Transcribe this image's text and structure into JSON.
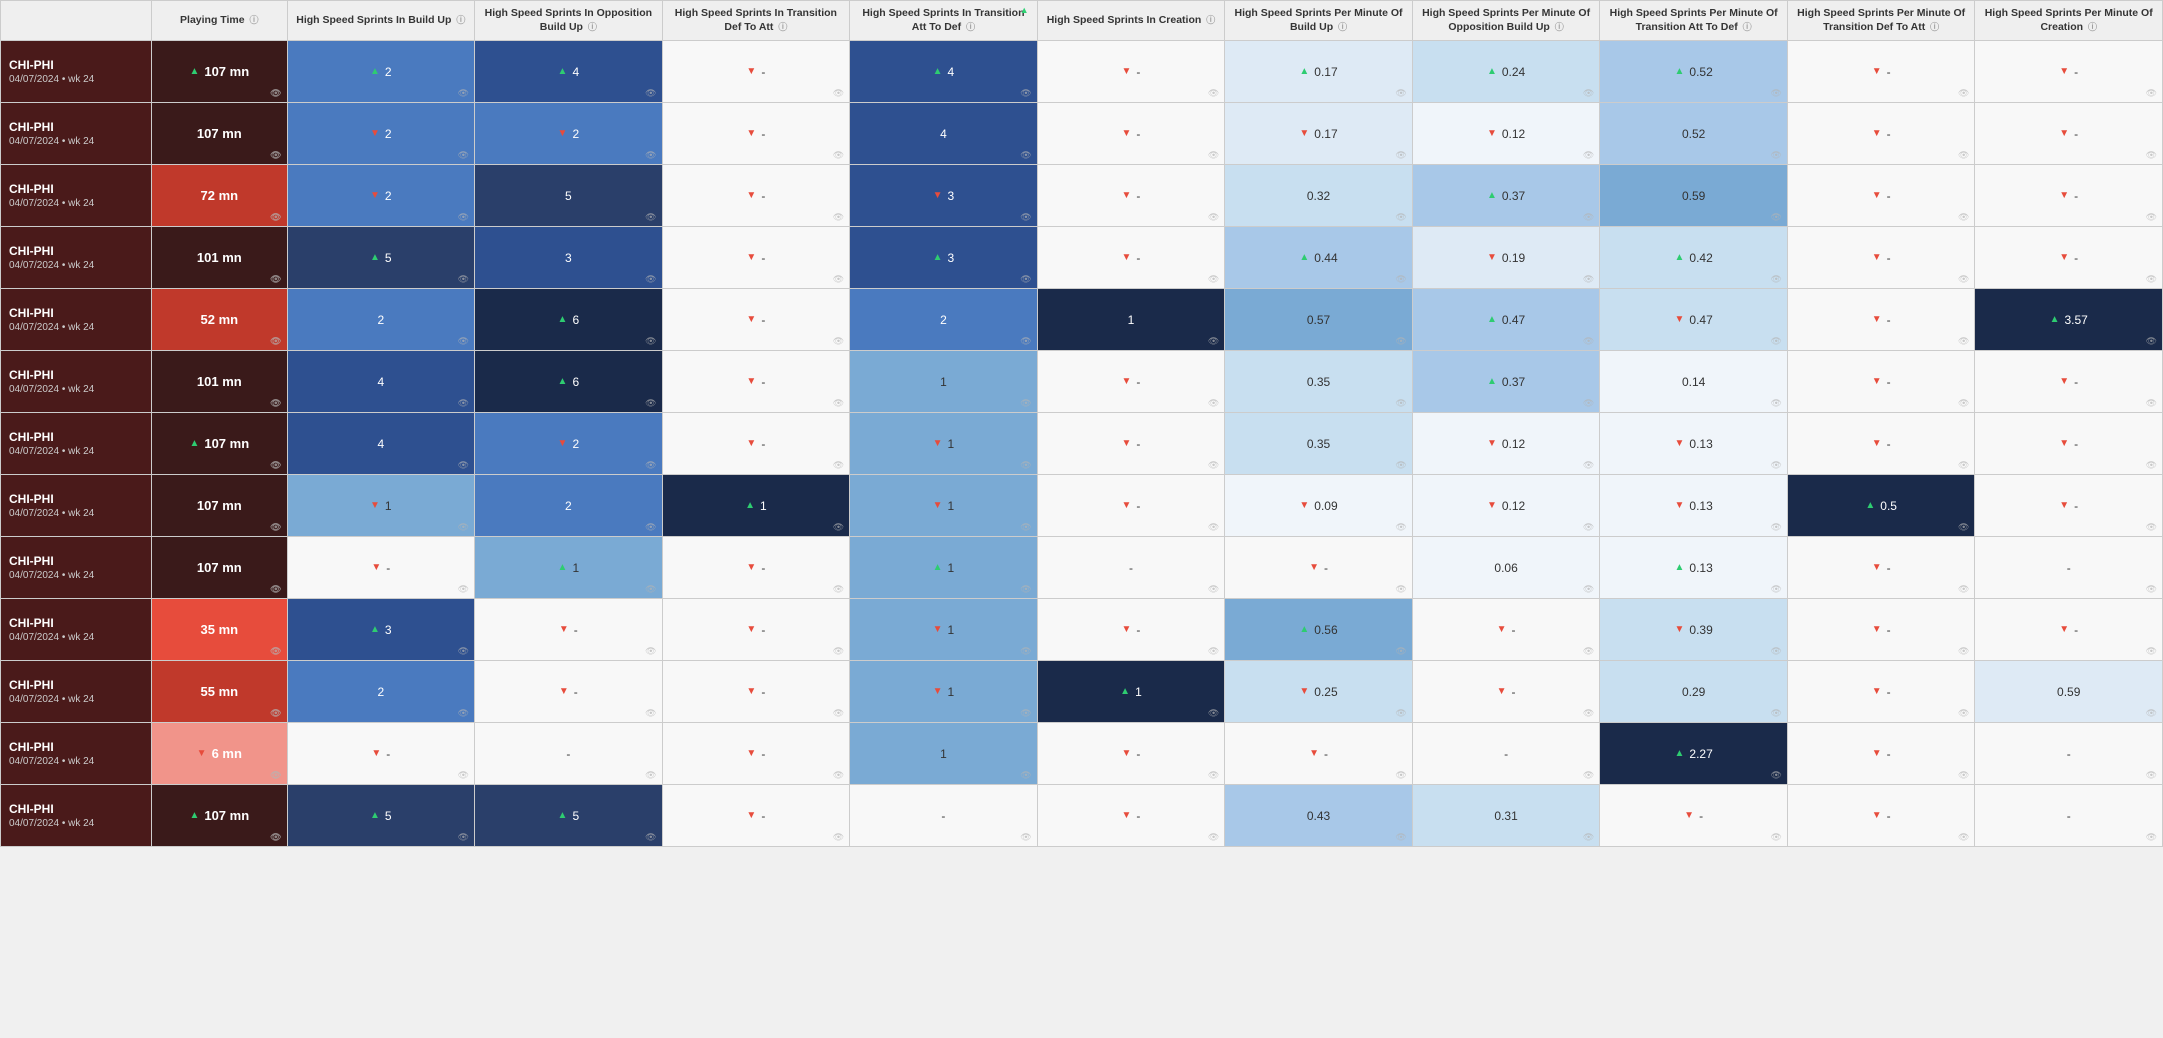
{
  "columns": [
    {
      "id": "player",
      "label": ""
    },
    {
      "id": "playing_time",
      "label": "Playing Time"
    },
    {
      "id": "hs_buildup",
      "label": "High Speed Sprints In Build Up"
    },
    {
      "id": "hs_opp_buildup",
      "label": "High Speed Sprints In Opposition Build Up"
    },
    {
      "id": "hs_trans_def_att",
      "label": "High Speed Sprints In Transition Def To Att"
    },
    {
      "id": "hs_trans_att_def",
      "label": "High Speed Sprints In Transition Att To Def"
    },
    {
      "id": "hs_creation",
      "label": "High Speed Sprints In Creation"
    },
    {
      "id": "hs_pm_buildup",
      "label": "High Speed Sprints Per Minute Of Build Up"
    },
    {
      "id": "hs_pm_opp_buildup",
      "label": "High Speed Sprints Per Minute Of Opposition Build Up"
    },
    {
      "id": "hs_pm_trans_att_def",
      "label": "High Speed Sprints Per Minute Of Transition Att To Def"
    },
    {
      "id": "hs_pm_trans_def_att",
      "label": "High Speed Sprints Per Minute Of Transition Def To Att"
    },
    {
      "id": "hs_pm_creation",
      "label": "High Speed Sprints Per Minute Of Creation"
    }
  ],
  "rows": [
    {
      "player": "CHI-PHI",
      "date": "04/07/2024 • wk 24",
      "pt_value": "107 mn",
      "pt_class": "pt-dark",
      "pt_arrow": "up",
      "hs_buildup": {
        "val": "2",
        "arrow": "up",
        "bg": "bg-medblue"
      },
      "hs_opp_buildup": {
        "val": "4",
        "arrow": "up",
        "bg": "bg-darkblue"
      },
      "hs_trans_def_att": {
        "val": "-",
        "arrow": "down",
        "bg": "bg-plain"
      },
      "hs_trans_att_def": {
        "val": "4",
        "arrow": "up",
        "bg": "bg-darkblue"
      },
      "hs_creation": {
        "val": "-",
        "arrow": "down",
        "bg": "bg-plain"
      },
      "hs_pm_buildup": {
        "val": "0.17",
        "arrow": "up",
        "bg": "bg-verylight"
      },
      "hs_pm_opp_buildup": {
        "val": "0.24",
        "arrow": "up",
        "bg": "bg-paleblue"
      },
      "hs_pm_trans_att_def": {
        "val": "0.52",
        "arrow": "up",
        "bg": "bg-lighterblue"
      },
      "hs_pm_trans_def_att": {
        "val": "-",
        "arrow": "down",
        "bg": "bg-plain"
      },
      "hs_pm_creation": {
        "val": "-",
        "arrow": "down",
        "bg": "bg-plain"
      }
    },
    {
      "player": "CHI-PHI",
      "date": "04/07/2024 • wk 24",
      "pt_value": "107 mn",
      "pt_class": "pt-dark",
      "pt_arrow": "none",
      "hs_buildup": {
        "val": "2",
        "arrow": "down",
        "bg": "bg-medblue"
      },
      "hs_opp_buildup": {
        "val": "2",
        "arrow": "down",
        "bg": "bg-medblue"
      },
      "hs_trans_def_att": {
        "val": "-",
        "arrow": "down",
        "bg": "bg-plain"
      },
      "hs_trans_att_def": {
        "val": "4",
        "arrow": "none",
        "bg": "bg-darkblue"
      },
      "hs_creation": {
        "val": "-",
        "arrow": "down",
        "bg": "bg-plain"
      },
      "hs_pm_buildup": {
        "val": "0.17",
        "arrow": "down",
        "bg": "bg-verylight"
      },
      "hs_pm_opp_buildup": {
        "val": "0.12",
        "arrow": "down",
        "bg": "bg-white"
      },
      "hs_pm_trans_att_def": {
        "val": "0.52",
        "arrow": "none",
        "bg": "bg-lighterblue"
      },
      "hs_pm_trans_def_att": {
        "val": "-",
        "arrow": "down",
        "bg": "bg-plain"
      },
      "hs_pm_creation": {
        "val": "-",
        "arrow": "down",
        "bg": "bg-plain"
      }
    },
    {
      "player": "CHI-PHI",
      "date": "04/07/2024 • wk 24",
      "pt_value": "72 mn",
      "pt_class": "pt-red-dark",
      "pt_arrow": "none",
      "hs_buildup": {
        "val": "2",
        "arrow": "down",
        "bg": "bg-medblue"
      },
      "hs_opp_buildup": {
        "val": "5",
        "arrow": "none",
        "bg": "bg-navy"
      },
      "hs_trans_def_att": {
        "val": "-",
        "arrow": "down",
        "bg": "bg-plain"
      },
      "hs_trans_att_def": {
        "val": "3",
        "arrow": "down",
        "bg": "bg-darkblue"
      },
      "hs_creation": {
        "val": "-",
        "arrow": "down",
        "bg": "bg-plain"
      },
      "hs_pm_buildup": {
        "val": "0.32",
        "arrow": "none",
        "bg": "bg-paleblue"
      },
      "hs_pm_opp_buildup": {
        "val": "0.37",
        "arrow": "up",
        "bg": "bg-lighterblue"
      },
      "hs_pm_trans_att_def": {
        "val": "0.59",
        "arrow": "none",
        "bg": "bg-lightblue"
      },
      "hs_pm_trans_def_att": {
        "val": "-",
        "arrow": "down",
        "bg": "bg-plain"
      },
      "hs_pm_creation": {
        "val": "-",
        "arrow": "down",
        "bg": "bg-plain"
      }
    },
    {
      "player": "CHI-PHI",
      "date": "04/07/2024 • wk 24",
      "pt_value": "101 mn",
      "pt_class": "pt-dark",
      "pt_arrow": "none",
      "hs_buildup": {
        "val": "5",
        "arrow": "up",
        "bg": "bg-navy"
      },
      "hs_opp_buildup": {
        "val": "3",
        "arrow": "none",
        "bg": "bg-darkblue"
      },
      "hs_trans_def_att": {
        "val": "-",
        "arrow": "down",
        "bg": "bg-plain"
      },
      "hs_trans_att_def": {
        "val": "3",
        "arrow": "up",
        "bg": "bg-darkblue"
      },
      "hs_creation": {
        "val": "-",
        "arrow": "down",
        "bg": "bg-plain"
      },
      "hs_pm_buildup": {
        "val": "0.44",
        "arrow": "up",
        "bg": "bg-lighterblue"
      },
      "hs_pm_opp_buildup": {
        "val": "0.19",
        "arrow": "down",
        "bg": "bg-verylight"
      },
      "hs_pm_trans_att_def": {
        "val": "0.42",
        "arrow": "up",
        "bg": "bg-paleblue"
      },
      "hs_pm_trans_def_att": {
        "val": "-",
        "arrow": "down",
        "bg": "bg-plain"
      },
      "hs_pm_creation": {
        "val": "-",
        "arrow": "down",
        "bg": "bg-plain"
      }
    },
    {
      "player": "CHI-PHI",
      "date": "04/07/2024 • wk 24",
      "pt_value": "52 mn",
      "pt_class": "pt-red-dark",
      "pt_arrow": "none",
      "hs_buildup": {
        "val": "2",
        "arrow": "none",
        "bg": "bg-medblue"
      },
      "hs_opp_buildup": {
        "val": "6",
        "arrow": "up",
        "bg": "bg-darknavy"
      },
      "hs_trans_def_att": {
        "val": "-",
        "arrow": "down",
        "bg": "bg-plain"
      },
      "hs_trans_att_def": {
        "val": "2",
        "arrow": "none",
        "bg": "bg-medblue"
      },
      "hs_creation": {
        "val": "1",
        "arrow": "none",
        "bg": "bg-darknavy"
      },
      "hs_pm_buildup": {
        "val": "0.57",
        "arrow": "none",
        "bg": "bg-lightblue"
      },
      "hs_pm_opp_buildup": {
        "val": "0.47",
        "arrow": "up",
        "bg": "bg-lighterblue"
      },
      "hs_pm_trans_att_def": {
        "val": "0.47",
        "arrow": "down",
        "bg": "bg-paleblue"
      },
      "hs_pm_trans_def_att": {
        "val": "-",
        "arrow": "down",
        "bg": "bg-plain"
      },
      "hs_pm_creation": {
        "val": "3.57",
        "arrow": "up",
        "bg": "bg-darknavy"
      }
    },
    {
      "player": "CHI-PHI",
      "date": "04/07/2024 • wk 24",
      "pt_value": "101 mn",
      "pt_class": "pt-dark",
      "pt_arrow": "none",
      "hs_buildup": {
        "val": "4",
        "arrow": "none",
        "bg": "bg-darkblue"
      },
      "hs_opp_buildup": {
        "val": "6",
        "arrow": "up",
        "bg": "bg-darknavy"
      },
      "hs_trans_def_att": {
        "val": "-",
        "arrow": "down",
        "bg": "bg-plain"
      },
      "hs_trans_att_def": {
        "val": "1",
        "arrow": "none",
        "bg": "bg-lightblue"
      },
      "hs_creation": {
        "val": "-",
        "arrow": "down",
        "bg": "bg-plain"
      },
      "hs_pm_buildup": {
        "val": "0.35",
        "arrow": "none",
        "bg": "bg-paleblue"
      },
      "hs_pm_opp_buildup": {
        "val": "0.37",
        "arrow": "up",
        "bg": "bg-lighterblue"
      },
      "hs_pm_trans_att_def": {
        "val": "0.14",
        "arrow": "none",
        "bg": "bg-white"
      },
      "hs_pm_trans_def_att": {
        "val": "-",
        "arrow": "down",
        "bg": "bg-plain"
      },
      "hs_pm_creation": {
        "val": "-",
        "arrow": "down",
        "bg": "bg-plain"
      }
    },
    {
      "player": "CHI-PHI",
      "date": "04/07/2024 • wk 24",
      "pt_value": "107 mn",
      "pt_class": "pt-dark",
      "pt_arrow": "up",
      "hs_buildup": {
        "val": "4",
        "arrow": "none",
        "bg": "bg-darkblue"
      },
      "hs_opp_buildup": {
        "val": "2",
        "arrow": "down",
        "bg": "bg-medblue"
      },
      "hs_trans_def_att": {
        "val": "-",
        "arrow": "down",
        "bg": "bg-plain"
      },
      "hs_trans_att_def": {
        "val": "1",
        "arrow": "down",
        "bg": "bg-lightblue"
      },
      "hs_creation": {
        "val": "-",
        "arrow": "down",
        "bg": "bg-plain"
      },
      "hs_pm_buildup": {
        "val": "0.35",
        "arrow": "none",
        "bg": "bg-paleblue"
      },
      "hs_pm_opp_buildup": {
        "val": "0.12",
        "arrow": "down",
        "bg": "bg-white"
      },
      "hs_pm_trans_att_def": {
        "val": "0.13",
        "arrow": "down",
        "bg": "bg-white"
      },
      "hs_pm_trans_def_att": {
        "val": "-",
        "arrow": "down",
        "bg": "bg-plain"
      },
      "hs_pm_creation": {
        "val": "-",
        "arrow": "down",
        "bg": "bg-plain"
      }
    },
    {
      "player": "CHI-PHI",
      "date": "04/07/2024 • wk 24",
      "pt_value": "107 mn",
      "pt_class": "pt-dark",
      "pt_arrow": "none",
      "hs_buildup": {
        "val": "1",
        "arrow": "down",
        "bg": "bg-lightblue"
      },
      "hs_opp_buildup": {
        "val": "2",
        "arrow": "none",
        "bg": "bg-medblue"
      },
      "hs_trans_def_att": {
        "val": "1",
        "arrow": "up",
        "bg": "bg-darknavy"
      },
      "hs_trans_att_def": {
        "val": "1",
        "arrow": "down",
        "bg": "bg-lightblue"
      },
      "hs_creation": {
        "val": "-",
        "arrow": "down",
        "bg": "bg-plain"
      },
      "hs_pm_buildup": {
        "val": "0.09",
        "arrow": "down",
        "bg": "bg-white"
      },
      "hs_pm_opp_buildup": {
        "val": "0.12",
        "arrow": "down",
        "bg": "bg-white"
      },
      "hs_pm_trans_att_def": {
        "val": "0.13",
        "arrow": "down",
        "bg": "bg-white"
      },
      "hs_pm_trans_def_att": {
        "val": "0.5",
        "arrow": "up",
        "bg": "bg-darknavy"
      },
      "hs_pm_creation": {
        "val": "-",
        "arrow": "down",
        "bg": "bg-plain"
      }
    },
    {
      "player": "CHI-PHI",
      "date": "04/07/2024 • wk 24",
      "pt_value": "107 mn",
      "pt_class": "pt-dark",
      "pt_arrow": "none",
      "hs_buildup": {
        "val": "-",
        "arrow": "down",
        "bg": "bg-plain"
      },
      "hs_opp_buildup": {
        "val": "1",
        "arrow": "up",
        "bg": "bg-lightblue"
      },
      "hs_trans_def_att": {
        "val": "-",
        "arrow": "down",
        "bg": "bg-plain"
      },
      "hs_trans_att_def": {
        "val": "1",
        "arrow": "up",
        "bg": "bg-lightblue"
      },
      "hs_creation": {
        "val": "-",
        "arrow": "none",
        "bg": "bg-plain"
      },
      "hs_pm_buildup": {
        "val": "-",
        "arrow": "down",
        "bg": "bg-plain"
      },
      "hs_pm_opp_buildup": {
        "val": "0.06",
        "arrow": "none",
        "bg": "bg-white"
      },
      "hs_pm_trans_att_def": {
        "val": "0.13",
        "arrow": "up",
        "bg": "bg-white"
      },
      "hs_pm_trans_def_att": {
        "val": "-",
        "arrow": "down",
        "bg": "bg-plain"
      },
      "hs_pm_creation": {
        "val": "-",
        "arrow": "none",
        "bg": "bg-plain"
      }
    },
    {
      "player": "CHI-PHI",
      "date": "04/07/2024 • wk 24",
      "pt_value": "35 mn",
      "pt_class": "pt-red-medium",
      "pt_arrow": "none",
      "hs_buildup": {
        "val": "3",
        "arrow": "up",
        "bg": "bg-darkblue"
      },
      "hs_opp_buildup": {
        "val": "-",
        "arrow": "down",
        "bg": "bg-plain"
      },
      "hs_trans_def_att": {
        "val": "-",
        "arrow": "down",
        "bg": "bg-plain"
      },
      "hs_trans_att_def": {
        "val": "1",
        "arrow": "down",
        "bg": "bg-lightblue"
      },
      "hs_creation": {
        "val": "-",
        "arrow": "down",
        "bg": "bg-plain"
      },
      "hs_pm_buildup": {
        "val": "0.56",
        "arrow": "up",
        "bg": "bg-lightblue"
      },
      "hs_pm_opp_buildup": {
        "val": "-",
        "arrow": "down",
        "bg": "bg-plain"
      },
      "hs_pm_trans_att_def": {
        "val": "0.39",
        "arrow": "down",
        "bg": "bg-paleblue"
      },
      "hs_pm_trans_def_att": {
        "val": "-",
        "arrow": "down",
        "bg": "bg-plain"
      },
      "hs_pm_creation": {
        "val": "-",
        "arrow": "down",
        "bg": "bg-plain"
      }
    },
    {
      "player": "CHI-PHI",
      "date": "04/07/2024 • wk 24",
      "pt_value": "55 mn",
      "pt_class": "pt-red-dark",
      "pt_arrow": "none",
      "hs_buildup": {
        "val": "2",
        "arrow": "none",
        "bg": "bg-medblue"
      },
      "hs_opp_buildup": {
        "val": "-",
        "arrow": "down",
        "bg": "bg-plain"
      },
      "hs_trans_def_att": {
        "val": "-",
        "arrow": "down",
        "bg": "bg-plain"
      },
      "hs_trans_att_def": {
        "val": "1",
        "arrow": "down",
        "bg": "bg-lightblue"
      },
      "hs_creation": {
        "val": "1",
        "arrow": "up",
        "bg": "bg-darknavy"
      },
      "hs_pm_buildup": {
        "val": "0.25",
        "arrow": "down",
        "bg": "bg-paleblue"
      },
      "hs_pm_opp_buildup": {
        "val": "-",
        "arrow": "down",
        "bg": "bg-plain"
      },
      "hs_pm_trans_att_def": {
        "val": "0.29",
        "arrow": "none",
        "bg": "bg-paleblue"
      },
      "hs_pm_trans_def_att": {
        "val": "-",
        "arrow": "down",
        "bg": "bg-plain"
      },
      "hs_pm_creation": {
        "val": "0.59",
        "arrow": "none",
        "bg": "bg-verylight"
      }
    },
    {
      "player": "CHI-PHI",
      "date": "04/07/2024 • wk 24",
      "pt_value": "6 mn",
      "pt_class": "pt-red-light",
      "pt_arrow": "down",
      "hs_buildup": {
        "val": "-",
        "arrow": "down",
        "bg": "bg-plain"
      },
      "hs_opp_buildup": {
        "val": "-",
        "arrow": "none",
        "bg": "bg-plain"
      },
      "hs_trans_def_att": {
        "val": "-",
        "arrow": "down",
        "bg": "bg-plain"
      },
      "hs_trans_att_def": {
        "val": "1",
        "arrow": "none",
        "bg": "bg-lightblue"
      },
      "hs_creation": {
        "val": "-",
        "arrow": "down",
        "bg": "bg-plain"
      },
      "hs_pm_buildup": {
        "val": "-",
        "arrow": "down",
        "bg": "bg-plain"
      },
      "hs_pm_opp_buildup": {
        "val": "-",
        "arrow": "none",
        "bg": "bg-plain"
      },
      "hs_pm_trans_att_def": {
        "val": "2.27",
        "arrow": "up",
        "bg": "bg-darknavy"
      },
      "hs_pm_trans_def_att": {
        "val": "-",
        "arrow": "down",
        "bg": "bg-plain"
      },
      "hs_pm_creation": {
        "val": "-",
        "arrow": "none",
        "bg": "bg-plain"
      }
    },
    {
      "player": "CHI-PHI",
      "date": "04/07/2024 • wk 24",
      "pt_value": "107 mn",
      "pt_class": "pt-dark",
      "pt_arrow": "up",
      "hs_buildup": {
        "val": "5",
        "arrow": "up",
        "bg": "bg-navy"
      },
      "hs_opp_buildup": {
        "val": "5",
        "arrow": "up",
        "bg": "bg-navy"
      },
      "hs_trans_def_att": {
        "val": "-",
        "arrow": "down",
        "bg": "bg-plain"
      },
      "hs_trans_att_def": {
        "val": "-",
        "arrow": "none",
        "bg": "bg-plain"
      },
      "hs_creation": {
        "val": "-",
        "arrow": "down",
        "bg": "bg-plain"
      },
      "hs_pm_buildup": {
        "val": "0.43",
        "arrow": "none",
        "bg": "bg-lighterblue"
      },
      "hs_pm_opp_buildup": {
        "val": "0.31",
        "arrow": "none",
        "bg": "bg-paleblue"
      },
      "hs_pm_trans_att_def": {
        "val": "-",
        "arrow": "down",
        "bg": "bg-plain"
      },
      "hs_pm_trans_def_att": {
        "val": "-",
        "arrow": "down",
        "bg": "bg-plain"
      },
      "hs_pm_creation": {
        "val": "-",
        "arrow": "none",
        "bg": "bg-plain"
      }
    }
  ],
  "sort_column": "hs_trans_att_def",
  "ui": {
    "arrow_up": "▲",
    "arrow_down": "▼",
    "eye": "👁",
    "info": "ⓘ",
    "sort_indicator": "▲"
  }
}
